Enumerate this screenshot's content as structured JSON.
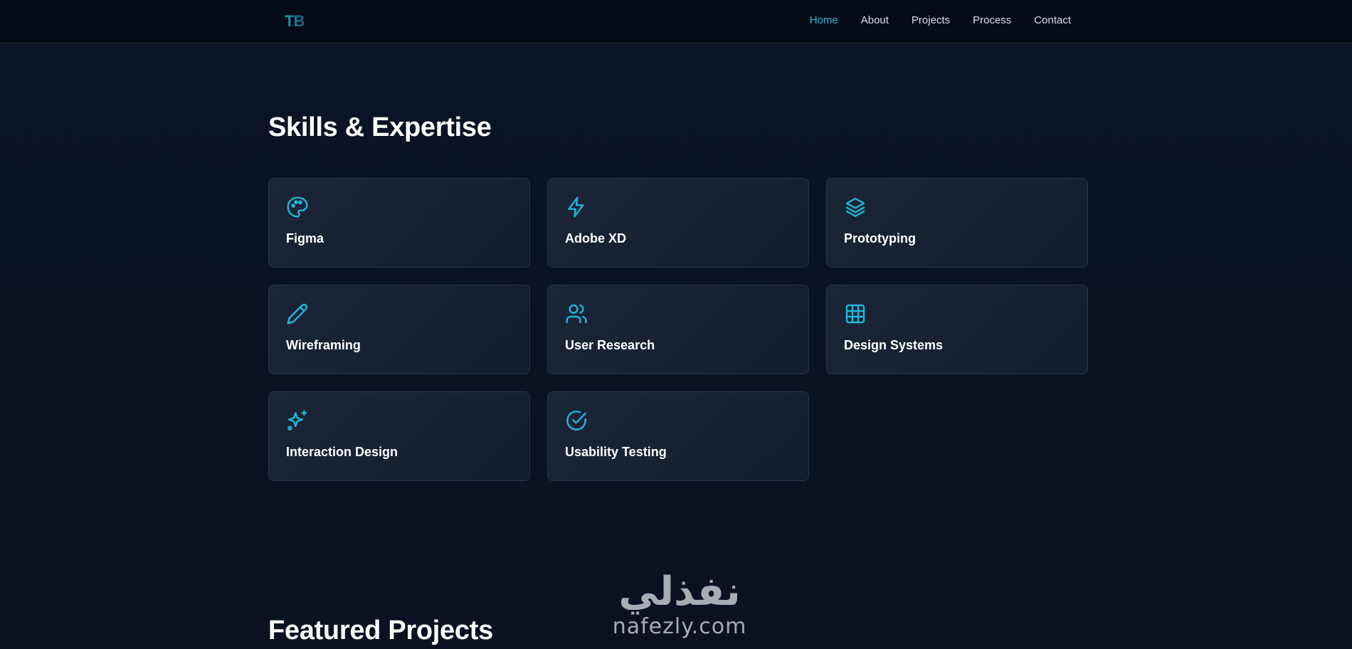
{
  "nav": {
    "logo": "TB",
    "links": [
      {
        "label": "Home",
        "active": true
      },
      {
        "label": "About",
        "active": false
      },
      {
        "label": "Projects",
        "active": false
      },
      {
        "label": "Process",
        "active": false
      },
      {
        "label": "Contact",
        "active": false
      }
    ]
  },
  "skills": {
    "title": "Skills & Expertise",
    "items": [
      {
        "label": "Figma",
        "icon": "palette-icon"
      },
      {
        "label": "Adobe XD",
        "icon": "lightning-icon"
      },
      {
        "label": "Prototyping",
        "icon": "layers-icon"
      },
      {
        "label": "Wireframing",
        "icon": "pencil-icon"
      },
      {
        "label": "User Research",
        "icon": "users-icon"
      },
      {
        "label": "Design Systems",
        "icon": "grid-icon"
      },
      {
        "label": "Interaction Design",
        "icon": "sparkles-icon"
      },
      {
        "label": "Usability Testing",
        "icon": "check-circle-icon"
      }
    ]
  },
  "projects": {
    "title": "Featured Projects"
  },
  "watermark": {
    "arabic": "نفذلي",
    "latin": "nafezly.com"
  },
  "colors": {
    "accent": "#22b6d8",
    "background": "#0b1325",
    "card": "#172033",
    "nav_bg": "#060b18"
  }
}
